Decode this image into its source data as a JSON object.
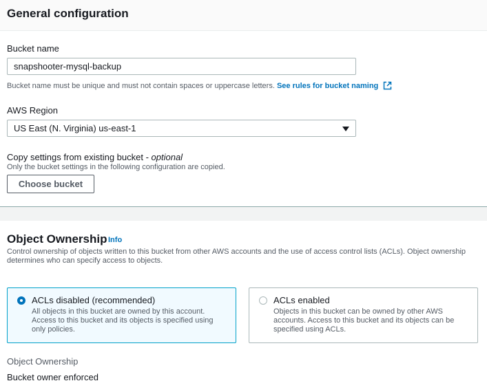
{
  "general": {
    "title": "General configuration",
    "bucket_name_label": "Bucket name",
    "bucket_name_value": "snapshooter-mysql-backup",
    "bucket_name_help": "Bucket name must be unique and must not contain spaces or uppercase letters.",
    "bucket_naming_link": "See rules for bucket naming",
    "region_label": "AWS Region",
    "region_value": "US East (N. Virginia) us-east-1",
    "copy_label": "Copy settings from existing bucket - ",
    "copy_optional": "optional",
    "copy_help": "Only the bucket settings in the following configuration are copied.",
    "choose_bucket_button": "Choose bucket"
  },
  "ownership": {
    "title": "Object Ownership",
    "info_link": "Info",
    "description": "Control ownership of objects written to this bucket from other AWS accounts and the use of access control lists (ACLs). Object ownership determines who can specify access to objects.",
    "options": [
      {
        "title": "ACLs disabled (recommended)",
        "description": "All objects in this bucket are owned by this account. Access to this bucket and its objects is specified using only policies.",
        "selected": true
      },
      {
        "title": "ACLs enabled",
        "description": "Objects in this bucket can be owned by other AWS accounts. Access to this bucket and its objects can be specified using ACLs.",
        "selected": false
      }
    ],
    "summary_key": "Object Ownership",
    "summary_value": "Bucket owner enforced"
  },
  "colors": {
    "link": "#0073bb",
    "selected_border": "#00a1c9",
    "selected_bg": "#f1faff"
  }
}
